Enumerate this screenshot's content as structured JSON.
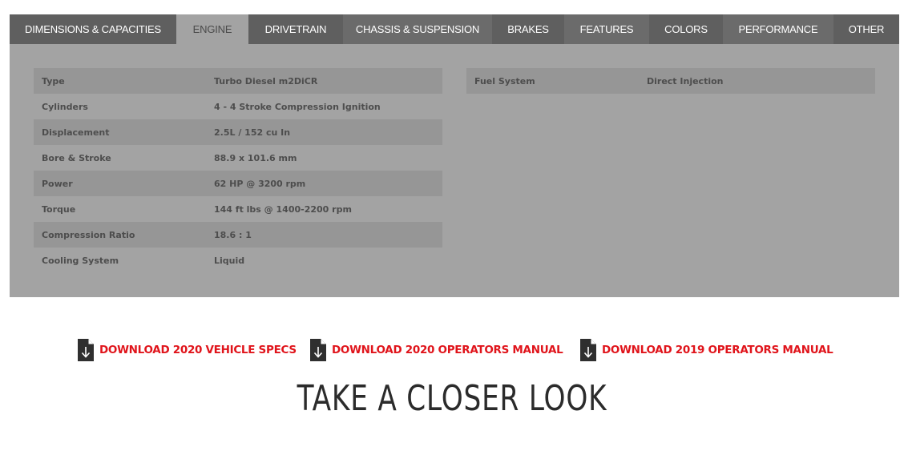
{
  "tabs": [
    {
      "label": "DIMENSIONS & CAPACITIES"
    },
    {
      "label": "ENGINE"
    },
    {
      "label": "DRIVETRAIN"
    },
    {
      "label": "CHASSIS & SUSPENSION"
    },
    {
      "label": "BRAKES"
    },
    {
      "label": "FEATURES"
    },
    {
      "label": "COLORS"
    },
    {
      "label": "PERFORMANCE"
    },
    {
      "label": "OTHER"
    }
  ],
  "active_tab": "ENGINE",
  "specs_left": [
    {
      "label": "Type",
      "value": "Turbo Diesel m2DiCR"
    },
    {
      "label": "Cylinders",
      "value": "4 - 4 Stroke Compression Ignition"
    },
    {
      "label": "Displacement",
      "value": "2.5L / 152 cu In"
    },
    {
      "label": "Bore & Stroke",
      "value": "88.9 x 101.6 mm"
    },
    {
      "label": "Power",
      "value": "62 HP @ 3200 rpm"
    },
    {
      "label": "Torque",
      "value": "144 ft lbs @ 1400-2200 rpm"
    },
    {
      "label": "Compression Ratio",
      "value": "18.6 : 1"
    },
    {
      "label": "Cooling System",
      "value": "Liquid"
    }
  ],
  "specs_right": [
    {
      "label": "Fuel System",
      "value": "Direct Injection"
    }
  ],
  "downloads": [
    {
      "label": "DOWNLOAD 2020 VEHICLE SPECS",
      "icon": "document-download-icon"
    },
    {
      "label": "DOWNLOAD 2020 OPERATORS MANUAL",
      "icon": "document-download-icon"
    },
    {
      "label": "DOWNLOAD 2019 OPERATORS MANUAL",
      "icon": "document-download-icon"
    }
  ],
  "section_heading": "TAKE A CLOSER LOOK",
  "colors": {
    "tab_bar": "#5f5f5f",
    "tab_active": "#a3a3a3",
    "panel": "#a3a3a3",
    "row_shaded": "#969696",
    "link_red": "#e0141b"
  }
}
